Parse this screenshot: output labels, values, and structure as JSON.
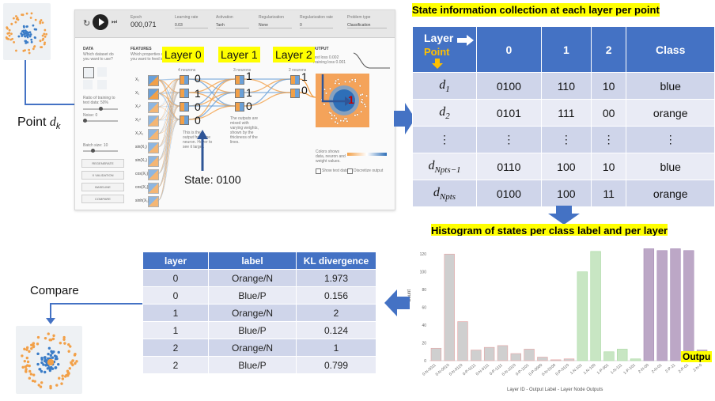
{
  "labels": {
    "point": "Point",
    "point_sub": "k",
    "state": "State: 0100",
    "compare": "Compare",
    "layer0": "Layer 0",
    "layer1": "Layer 1",
    "layer2": "Layer 2",
    "output": "Outpu",
    "layer_state_bits": {
      "layer0": [
        "0",
        "1",
        "0",
        "0"
      ],
      "layer1": [
        "1",
        "1",
        "0"
      ],
      "layer2": [
        "1",
        "0"
      ],
      "output_point": "1"
    }
  },
  "playground": {
    "top": {
      "epoch_label": "Epoch",
      "epoch_value": "000,071",
      "lr_label": "Learning rate",
      "lr_value": "0.03",
      "act_label": "Activation",
      "act_value": "Tanh",
      "reg_label": "Regularization",
      "reg_value": "None",
      "rate_label": "Regularization rate",
      "rate_value": "0",
      "problem_label": "Problem type",
      "problem_value": "Classification"
    },
    "data_title": "DATA",
    "data_q": "Which dataset do you want to use?",
    "ratio": "Ratio of training to test data:  50%",
    "noise": "Noise:  0",
    "batch": "Batch size:  10",
    "buttons": [
      "REGENERATE",
      "X VALIDATION",
      "BASELINE",
      "COMPARE"
    ],
    "features_title": "FEATURES",
    "features_q": "Which properties do you want to feed in?",
    "features": [
      "X₁",
      "X₂",
      "X₁²",
      "X₂²",
      "X₁X₂",
      "sin(X₁)",
      "sin(X₂)",
      "cos(X₁)",
      "cos(X₂)",
      "sinh(X₁)"
    ],
    "neurons_l0": "4 neurons",
    "neurons_l1": "3 neurons",
    "neurons_l2": "2 neurons",
    "output_title": "OUTPUT",
    "test_loss": "Test loss 0.002",
    "train_loss": "Training loss 0.001",
    "colors_note": "Colors shows data, neuron and weight values.",
    "show_test": "Show test data",
    "discretize": "Discretize output",
    "annot": "This is the output from one neuron. Hover to see it larger.",
    "annot2": "The outputs are mixed with varying weights, shown by the thickness of the lines."
  },
  "state_table": {
    "title": "State information collection at each layer per point",
    "header_layer": "Layer",
    "header_point": "Point",
    "columns": [
      "0",
      "1",
      "2",
      "Class"
    ],
    "rows": [
      {
        "id": "d",
        "sub": "1",
        "c0": "0100",
        "c1": "110",
        "c2": "10",
        "cls": "blue"
      },
      {
        "id": "d",
        "sub": "2",
        "c0": "0101",
        "c1": "111",
        "c2": "00",
        "cls": "orange"
      },
      {
        "id": "⋮",
        "sub": "",
        "c0": "⋮",
        "c1": "⋮",
        "c2": "⋮",
        "cls": "⋮"
      },
      {
        "id": "d",
        "sub": "Npts−1",
        "c0": "0110",
        "c1": "100",
        "c2": "10",
        "cls": "blue"
      },
      {
        "id": "d",
        "sub": "Npts",
        "c0": "0100",
        "c1": "100",
        "c2": "11",
        "cls": "orange"
      }
    ]
  },
  "kl_table": {
    "headers": [
      "layer",
      "label",
      "KL divergence"
    ],
    "rows": [
      {
        "layer": "0",
        "label": "Orange/N",
        "kl": "1.973"
      },
      {
        "layer": "0",
        "label": "Blue/P",
        "kl": "0.156"
      },
      {
        "layer": "1",
        "label": "Orange/N",
        "kl": "2"
      },
      {
        "layer": "1",
        "label": "Blue/P",
        "kl": "0.124"
      },
      {
        "layer": "2",
        "label": "Orange/N",
        "kl": "1"
      },
      {
        "layer": "2",
        "label": "Blue/P",
        "kl": "0.799"
      }
    ]
  },
  "chart_data": {
    "type": "bar",
    "title": "Histogram of states per class label and per layer",
    "xlabel": "Layer ID - Output Label - Layer Node Outputs",
    "ylabel": "Count",
    "ylim": [
      0,
      130
    ],
    "yticks": [
      0,
      20,
      40,
      60,
      80,
      100,
      120
    ],
    "categories": [
      "0-N-0011",
      "0-N-0010",
      "0-N-0110",
      "0-P-0111",
      "0-N-0111",
      "0-P-1111",
      "0-N-1010",
      "0-P-1101",
      "0-P-0000",
      "0-N-0100",
      "0-P-0110",
      "1-N-101",
      "1-N-100",
      "1-P-001",
      "1-N-111",
      "1-P-101",
      "2-N-00",
      "2-N-01",
      "2-P-11",
      "2-P-01",
      "2-N-0"
    ],
    "values": [
      14,
      120,
      44,
      12,
      15,
      17,
      8,
      13,
      4,
      1,
      2,
      100,
      123,
      10,
      13,
      2,
      126,
      124,
      126,
      124,
      12
    ],
    "bar_colors": [
      "#cfcfcf",
      "#cfcfcf",
      "#cfcfcf",
      "#cfcfcf",
      "#cfcfcf",
      "#cfcfcf",
      "#cfcfcf",
      "#cfcfcf",
      "#cfcfcf",
      "#cfcfcf",
      "#cfcfcf",
      "#c8e6c3",
      "#c8e6c3",
      "#c8e6c3",
      "#c8e6c3",
      "#c8e6c3",
      "#bca7c6",
      "#bca7c6",
      "#bca7c6",
      "#bca7c6",
      "#bca7c6"
    ],
    "grid": false
  }
}
